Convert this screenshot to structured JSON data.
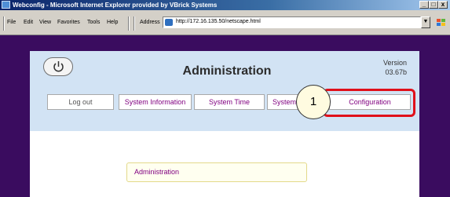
{
  "window": {
    "title": "Webconfig - Microsoft Internet Explorer provided by VBrick Systems",
    "controls": {
      "minimize": "_",
      "maximize": "□",
      "close": "x"
    }
  },
  "menubar": {
    "items": [
      "File",
      "Edit",
      "View",
      "Favorites",
      "Tools",
      "Help"
    ],
    "address_label": "Address",
    "url": "http://172.16.135.50/netscape.html"
  },
  "header": {
    "title": "Administration",
    "version_label": "Version",
    "version_value": "03.67b",
    "power_icon": "power-icon"
  },
  "nav": {
    "items": [
      "Log out",
      "System Information",
      "System Time",
      "System",
      "Configuration"
    ]
  },
  "callout": {
    "label": "1"
  },
  "admin_field": {
    "label": "Administration"
  },
  "colors": {
    "page_background": "#3a0c5f",
    "header_background": "#d2e3f4",
    "highlight": "#e0101a",
    "link_purple": "#800080"
  }
}
